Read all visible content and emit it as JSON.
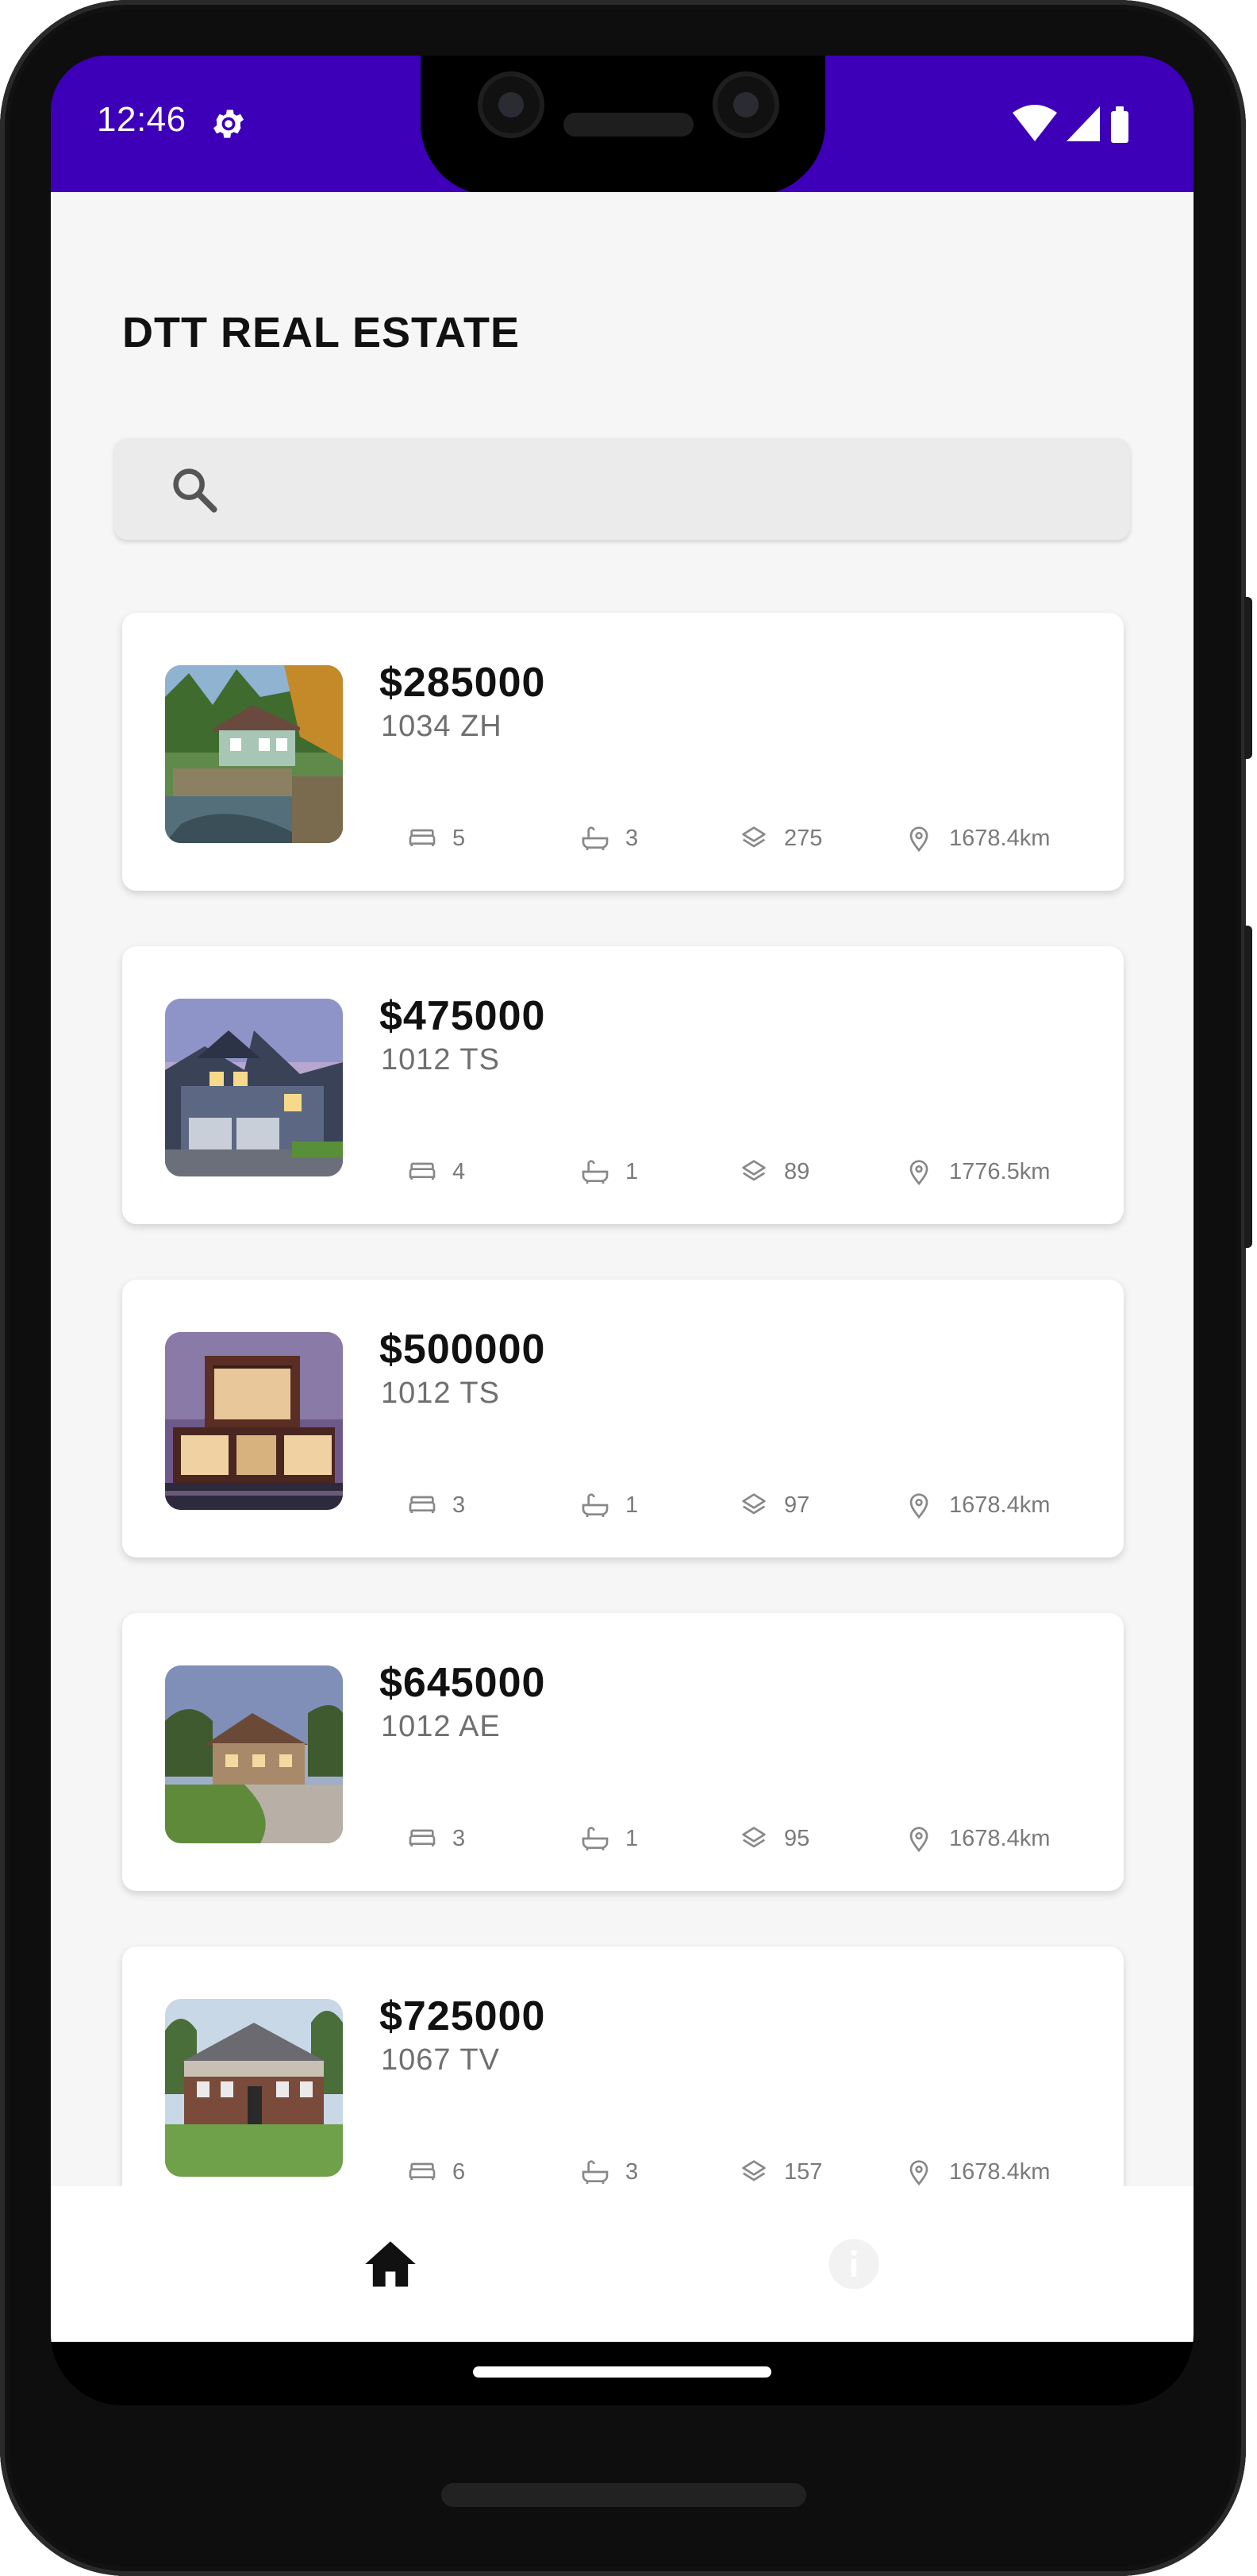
{
  "status_bar": {
    "time": "12:46",
    "settings_icon": "gear-icon",
    "wifi_icon": "wifi-icon",
    "signal_icon": "signal-icon",
    "battery_icon": "battery-icon",
    "bg_color": "#3d00b8"
  },
  "app": {
    "title": "DTT REAL ESTATE"
  },
  "search": {
    "icon": "search-icon",
    "placeholder": "",
    "value": ""
  },
  "listings": [
    {
      "price": "$285000",
      "zip": "1034 ZH",
      "bedrooms": "5",
      "bathrooms": "3",
      "size": "275",
      "distance": "1678.4km",
      "image": "house-photo-1"
    },
    {
      "price": "$475000",
      "zip": "1012 TS",
      "bedrooms": "4",
      "bathrooms": "1",
      "size": "89",
      "distance": "1776.5km",
      "image": "house-photo-2"
    },
    {
      "price": "$500000",
      "zip": "1012 TS",
      "bedrooms": "3",
      "bathrooms": "1",
      "size": "97",
      "distance": "1678.4km",
      "image": "house-photo-3"
    },
    {
      "price": "$645000",
      "zip": "1012 AE",
      "bedrooms": "3",
      "bathrooms": "1",
      "size": "95",
      "distance": "1678.4km",
      "image": "house-photo-4"
    },
    {
      "price": "$725000",
      "zip": "1067 TV",
      "bedrooms": "6",
      "bathrooms": "3",
      "size": "157",
      "distance": "1678.4km",
      "image": "house-photo-5"
    }
  ],
  "bottom_nav": [
    {
      "icon": "home-icon",
      "active": true
    },
    {
      "icon": "info-icon",
      "active": false
    }
  ]
}
